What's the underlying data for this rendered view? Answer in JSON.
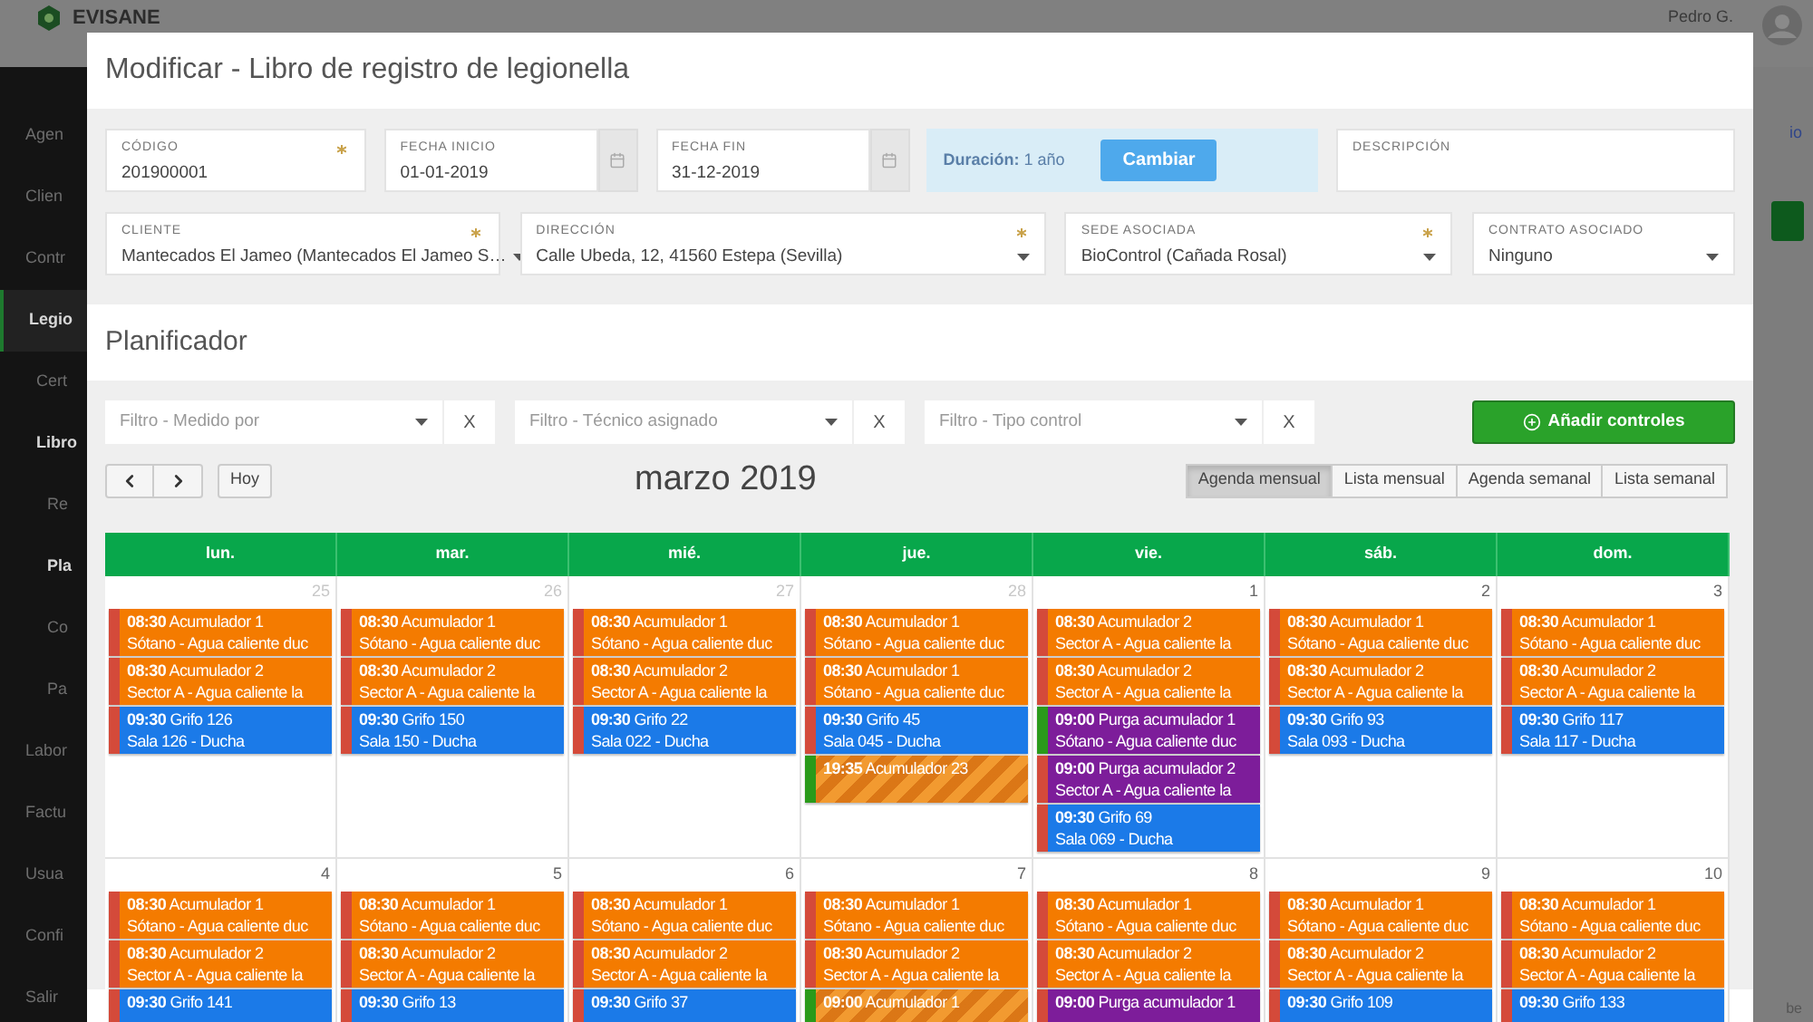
{
  "app": {
    "brand": "EVISANE",
    "user": "Pedro G.",
    "side_link": "io",
    "corner_text": "be",
    "sidebar": [
      {
        "label": "Agen",
        "selected": false
      },
      {
        "label": "Clien",
        "selected": false
      },
      {
        "label": "Contr",
        "selected": false
      },
      {
        "label": "Legio",
        "selected": true,
        "children": [
          {
            "label": "Cert",
            "selected": false
          },
          {
            "label": "Libro",
            "selected": true,
            "children": [
              {
                "label": "Re",
                "selected": false
              },
              {
                "label": "Pla",
                "selected": true
              },
              {
                "label": "Co",
                "selected": false
              },
              {
                "label": "Pa",
                "selected": false
              }
            ]
          }
        ]
      },
      {
        "label": "Labor",
        "selected": false
      },
      {
        "label": "Factu",
        "selected": false
      },
      {
        "label": "Usua",
        "selected": false
      },
      {
        "label": "Confi",
        "selected": false
      },
      {
        "label": "Salir",
        "selected": false
      }
    ]
  },
  "modal": {
    "title": "Modificar - Libro de registro de legionella",
    "form_rows": [
      [
        {
          "kind": "text",
          "label": "CÓDIGO",
          "value": "201900001",
          "required": true
        },
        {
          "kind": "date",
          "label": "FECHA INICIO",
          "value": "01-01-2019",
          "required": false
        },
        {
          "kind": "date",
          "label": "FECHA FIN",
          "value": "31-12-2019",
          "required": false
        },
        {
          "kind": "duration",
          "text": "**Duración:** 1 año",
          "button": "Cambiar"
        },
        {
          "kind": "text",
          "label": "DESCRIPCIÓN",
          "required": false
        }
      ],
      [
        {
          "kind": "select",
          "label": "CLIENTE",
          "value": "Mantecados El Jameo (Mantecados El Jameo S…",
          "required": true
        },
        {
          "kind": "select",
          "label": "DIRECCIÓN",
          "value": "Calle Ubeda, 12, 41560 Estepa (Sevilla)",
          "required": true
        },
        {
          "kind": "select",
          "label": "SEDE ASOCIADA",
          "value": "BioControl (Cañada Rosal)",
          "required": true
        },
        {
          "kind": "select",
          "label": "CONTRATO ASOCIADO",
          "value": "Ninguno",
          "required": false
        }
      ]
    ],
    "planner": {
      "title": "Planificador",
      "filters": [
        {
          "placeholder": "Filtro - Medido por",
          "clear": "X"
        },
        {
          "placeholder": "Filtro - Técnico asignado",
          "clear": "X"
        },
        {
          "placeholder": "Filtro - Tipo control",
          "clear": "X"
        }
      ],
      "add_button": "Añadir controles",
      "today": "Hoy",
      "month": "marzo 2019",
      "views": [
        {
          "label": "Agenda mensual",
          "selected": true
        },
        {
          "label": "Lista mensual",
          "selected": false
        },
        {
          "label": "Agenda semanal",
          "selected": false
        },
        {
          "label": "Lista semanal",
          "selected": false
        }
      ],
      "weekdays": [
        "lun.",
        "mar.",
        "mié.",
        "jue.",
        "vie.",
        "sáb.",
        "dom."
      ],
      "weeks": [
        [
          {
            "number": "25",
            "other_month": true,
            "events": [
              {
                "kind": "solid",
                "time": "08:30",
                "title": "Acumulador 1",
                "subtitle": "Sótano - Agua caliente duc",
                "color": "#f47b00",
                "done": false
              },
              {
                "kind": "solid",
                "time": "08:30",
                "title": "Acumulador 2",
                "subtitle": "Sector A - Agua caliente la",
                "color": "#f47b00",
                "done": false
              },
              {
                "kind": "solid",
                "time": "09:30",
                "title": "Grifo 126",
                "subtitle": "Sala 126 - Ducha",
                "color": "#1b7ae8",
                "done": false
              }
            ]
          },
          {
            "number": "26",
            "other_month": true,
            "events": [
              {
                "kind": "solid",
                "time": "08:30",
                "title": "Acumulador 1",
                "subtitle": "Sótano - Agua caliente duc",
                "color": "#f47b00",
                "done": false
              },
              {
                "kind": "solid",
                "time": "08:30",
                "title": "Acumulador 2",
                "subtitle": "Sector A - Agua caliente la",
                "color": "#f47b00",
                "done": false
              },
              {
                "kind": "solid",
                "time": "09:30",
                "title": "Grifo 150",
                "subtitle": "Sala 150 - Ducha",
                "color": "#1b7ae8",
                "done": false
              }
            ]
          },
          {
            "number": "27",
            "other_month": true,
            "events": [
              {
                "kind": "solid",
                "time": "08:30",
                "title": "Acumulador 1",
                "subtitle": "Sótano - Agua caliente duc",
                "color": "#f47b00",
                "done": false
              },
              {
                "kind": "solid",
                "time": "08:30",
                "title": "Acumulador 2",
                "subtitle": "Sector A - Agua caliente la",
                "color": "#f47b00",
                "done": false
              },
              {
                "kind": "solid",
                "time": "09:30",
                "title": "Grifo 22",
                "subtitle": "Sala 022 - Ducha",
                "color": "#1b7ae8",
                "done": false
              }
            ]
          },
          {
            "number": "28",
            "other_month": true,
            "events": [
              {
                "kind": "solid",
                "time": "08:30",
                "title": "Acumulador 1",
                "subtitle": "Sótano - Agua caliente duc",
                "color": "#f47b00",
                "done": false
              },
              {
                "kind": "solid",
                "time": "08:30",
                "title": "Acumulador 1",
                "subtitle": "Sótano - Agua caliente duc",
                "color": "#f47b00",
                "done": false
              },
              {
                "kind": "solid",
                "time": "09:30",
                "title": "Grifo 45",
                "subtitle": "Sala 045 - Ducha",
                "color": "#1b7ae8",
                "done": false
              },
              {
                "kind": "striped",
                "time": "19:35",
                "title": "Acumulador 23",
                "color": "#f29a30",
                "done": true
              }
            ]
          },
          {
            "number": "1",
            "other_month": false,
            "events": [
              {
                "kind": "solid",
                "time": "08:30",
                "title": "Acumulador 2",
                "subtitle": "Sector A - Agua caliente la",
                "color": "#f47b00",
                "done": false
              },
              {
                "kind": "solid",
                "time": "08:30",
                "title": "Acumulador 2",
                "subtitle": "Sector A - Agua caliente la",
                "color": "#f47b00",
                "done": false
              },
              {
                "kind": "solid",
                "time": "09:00",
                "title": "Purga acumulador 1",
                "subtitle": "Sótano - Agua caliente duc",
                "color": "#7d1d9a",
                "done": true
              },
              {
                "kind": "solid",
                "time": "09:00",
                "title": "Purga acumulador 2",
                "subtitle": "Sector A - Agua caliente la",
                "color": "#7d1d9a",
                "done": false
              },
              {
                "kind": "solid",
                "time": "09:30",
                "title": "Grifo 69",
                "subtitle": "Sala 069 - Ducha",
                "color": "#1b7ae8",
                "done": false
              }
            ]
          },
          {
            "number": "2",
            "other_month": false,
            "events": [
              {
                "kind": "solid",
                "time": "08:30",
                "title": "Acumulador 1",
                "subtitle": "Sótano - Agua caliente duc",
                "color": "#f47b00",
                "done": false
              },
              {
                "kind": "solid",
                "time": "08:30",
                "title": "Acumulador 2",
                "subtitle": "Sector A - Agua caliente la",
                "color": "#f47b00",
                "done": false
              },
              {
                "kind": "solid",
                "time": "09:30",
                "title": "Grifo 93",
                "subtitle": "Sala 093 - Ducha",
                "color": "#1b7ae8",
                "done": false
              }
            ]
          },
          {
            "number": "3",
            "other_month": false,
            "events": [
              {
                "kind": "solid",
                "time": "08:30",
                "title": "Acumulador 1",
                "subtitle": "Sótano - Agua caliente duc",
                "color": "#f47b00",
                "done": false
              },
              {
                "kind": "solid",
                "time": "08:30",
                "title": "Acumulador 2",
                "subtitle": "Sector A - Agua caliente la",
                "color": "#f47b00",
                "done": false
              },
              {
                "kind": "solid",
                "time": "09:30",
                "title": "Grifo 117",
                "subtitle": "Sala 117 - Ducha",
                "color": "#1b7ae8",
                "done": false
              }
            ]
          }
        ],
        [
          {
            "number": "4",
            "other_month": false,
            "events": [
              {
                "kind": "solid",
                "time": "08:30",
                "title": "Acumulador 1",
                "subtitle": "Sótano - Agua caliente duc",
                "color": "#f47b00",
                "done": false
              },
              {
                "kind": "solid",
                "time": "08:30",
                "title": "Acumulador 2",
                "subtitle": "Sector A - Agua caliente la",
                "color": "#f47b00",
                "done": false
              },
              {
                "kind": "solid",
                "time": "09:30",
                "title": "Grifo 141",
                "color": "#1b7ae8",
                "done": false
              }
            ]
          },
          {
            "number": "5",
            "other_month": false,
            "events": [
              {
                "kind": "solid",
                "time": "08:30",
                "title": "Acumulador 1",
                "subtitle": "Sótano - Agua caliente duc",
                "color": "#f47b00",
                "done": false
              },
              {
                "kind": "solid",
                "time": "08:30",
                "title": "Acumulador 2",
                "subtitle": "Sector A - Agua caliente la",
                "color": "#f47b00",
                "done": false
              },
              {
                "kind": "solid",
                "time": "09:30",
                "title": "Grifo 13",
                "color": "#1b7ae8",
                "done": false
              }
            ]
          },
          {
            "number": "6",
            "other_month": false,
            "events": [
              {
                "kind": "solid",
                "time": "08:30",
                "title": "Acumulador 1",
                "subtitle": "Sótano - Agua caliente duc",
                "color": "#f47b00",
                "done": false
              },
              {
                "kind": "solid",
                "time": "08:30",
                "title": "Acumulador 2",
                "subtitle": "Sector A - Agua caliente la",
                "color": "#f47b00",
                "done": false
              },
              {
                "kind": "solid",
                "time": "09:30",
                "title": "Grifo 37",
                "color": "#1b7ae8",
                "done": false
              }
            ]
          },
          {
            "number": "7",
            "other_month": false,
            "events": [
              {
                "kind": "solid",
                "time": "08:30",
                "title": "Acumulador 1",
                "subtitle": "Sótano - Agua caliente duc",
                "color": "#f47b00",
                "done": false
              },
              {
                "kind": "solid",
                "time": "08:30",
                "title": "Acumulador 2",
                "subtitle": "Sector A - Agua caliente la",
                "color": "#f47b00",
                "done": false
              },
              {
                "kind": "striped",
                "time": "09:00",
                "title": "Acumulador 1",
                "color": "#f29a30",
                "done": true
              }
            ]
          },
          {
            "number": "8",
            "other_month": false,
            "events": [
              {
                "kind": "solid",
                "time": "08:30",
                "title": "Acumulador 1",
                "subtitle": "Sótano - Agua caliente duc",
                "color": "#f47b00",
                "done": false
              },
              {
                "kind": "solid",
                "time": "08:30",
                "title": "Acumulador 2",
                "subtitle": "Sector A - Agua caliente la",
                "color": "#f47b00",
                "done": false
              },
              {
                "kind": "solid",
                "time": "09:00",
                "title": "Purga acumulador 1",
                "color": "#7d1d9a",
                "done": false
              }
            ]
          },
          {
            "number": "9",
            "other_month": false,
            "events": [
              {
                "kind": "solid",
                "time": "08:30",
                "title": "Acumulador 1",
                "subtitle": "Sótano - Agua caliente duc",
                "color": "#f47b00",
                "done": false
              },
              {
                "kind": "solid",
                "time": "08:30",
                "title": "Acumulador 2",
                "subtitle": "Sector A - Agua caliente la",
                "color": "#f47b00",
                "done": false
              },
              {
                "kind": "solid",
                "time": "09:30",
                "title": "Grifo 109",
                "color": "#1b7ae8",
                "done": false
              }
            ]
          },
          {
            "number": "10",
            "other_month": false,
            "events": [
              {
                "kind": "solid",
                "time": "08:30",
                "title": "Acumulador 1",
                "subtitle": "Sótano - Agua caliente duc",
                "color": "#f47b00",
                "done": false
              },
              {
                "kind": "solid",
                "time": "08:30",
                "title": "Acumulador 2",
                "subtitle": "Sector A - Agua caliente la",
                "color": "#f47b00",
                "done": false
              },
              {
                "kind": "solid",
                "time": "09:30",
                "title": "Grifo 133",
                "color": "#1b7ae8",
                "done": false
              }
            ]
          }
        ]
      ]
    }
  }
}
